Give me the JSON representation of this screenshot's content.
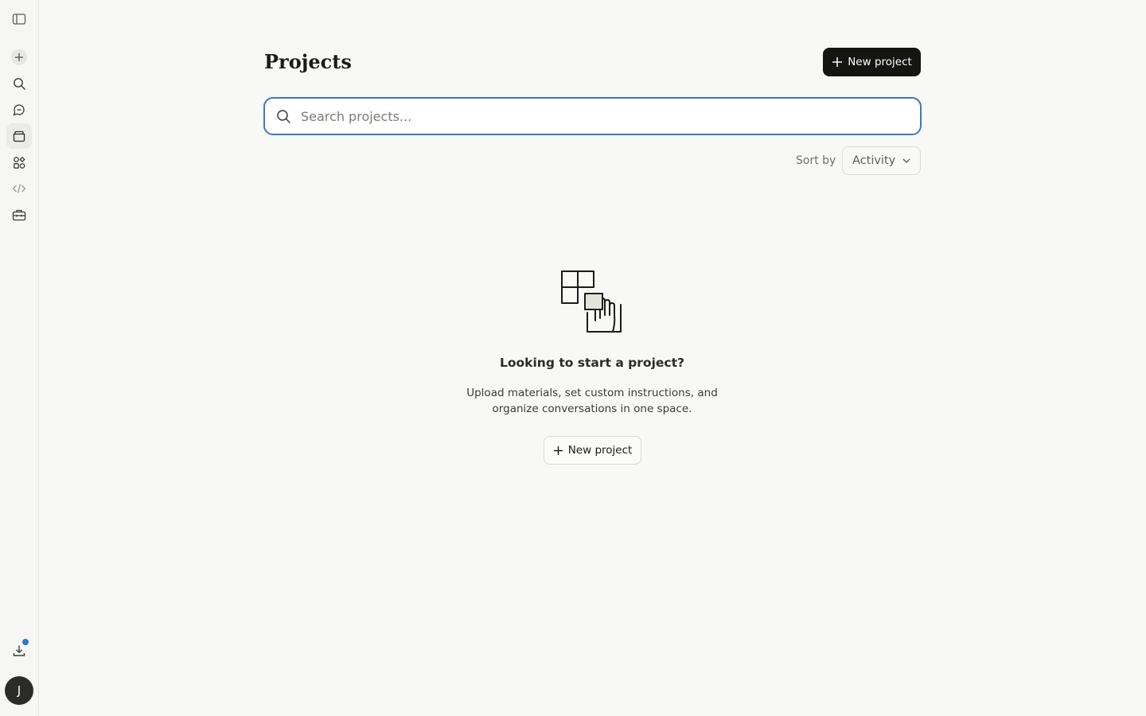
{
  "sidebar": {
    "items": [
      {
        "icon": "sidebar-toggle-icon"
      },
      {
        "icon": "plus-icon"
      },
      {
        "icon": "search-icon"
      },
      {
        "icon": "chats-icon"
      },
      {
        "icon": "projects-icon",
        "active": true
      },
      {
        "icon": "artifacts-icon"
      },
      {
        "icon": "code-icon"
      },
      {
        "icon": "toolbox-icon"
      },
      {
        "icon": "download-icon",
        "badge": true
      }
    ],
    "avatar_initial": "J",
    "notification_color": "#2c78d4"
  },
  "header": {
    "title": "Projects",
    "new_project_label": "New project"
  },
  "search": {
    "placeholder": "Search projects...",
    "value": ""
  },
  "sort": {
    "label": "Sort by",
    "selected": "Activity"
  },
  "empty_state": {
    "title": "Looking to start a project?",
    "description": "Upload materials, set custom instructions, and organize conversations in one space.",
    "button_label": "New project"
  },
  "colors": {
    "accent_focus": "#3a77c9",
    "primary_button": "#141413",
    "background": "#f8f8f6"
  }
}
